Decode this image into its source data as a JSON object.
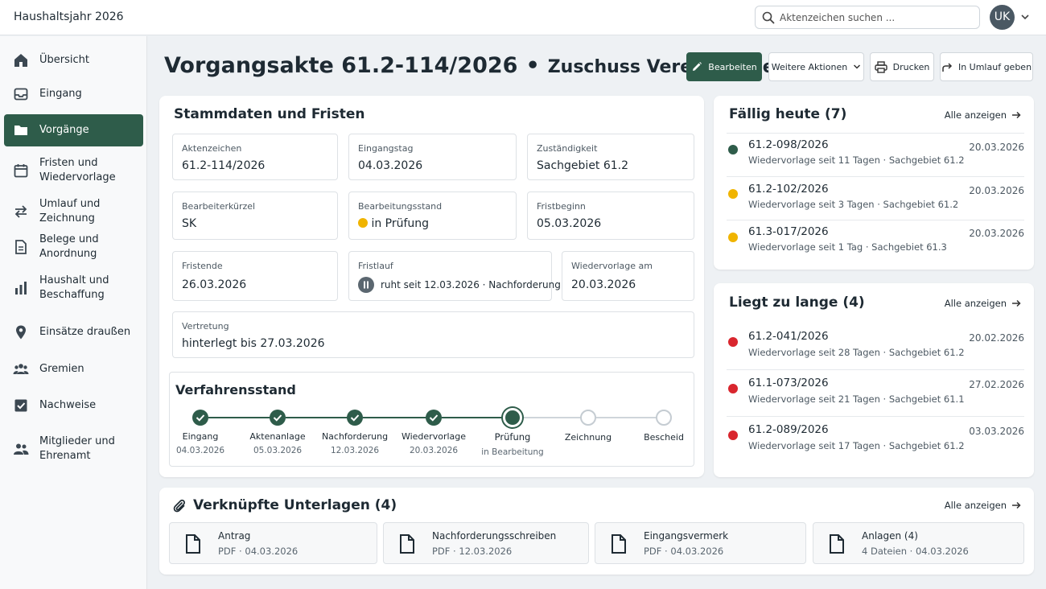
{
  "app": {
    "title": "Haushaltsjahr 2026"
  },
  "search": {
    "placeholder": "Aktenzeichen suchen ..."
  },
  "user": {
    "initials": "UK"
  },
  "sidebar": {
    "items": [
      {
        "label": "Übersicht",
        "icon": "home-icon"
      },
      {
        "label": "Eingang",
        "icon": "inbox-icon"
      },
      {
        "label": "Vorgänge",
        "icon": "folder-icon",
        "active": true
      },
      {
        "label": "Fristen und Wiedervorlage",
        "icon": "calendar-icon"
      },
      {
        "label": "Umlauf und Zeichnung",
        "icon": "swap-icon"
      },
      {
        "label": "Belege und Anordnung",
        "icon": "document-icon"
      },
      {
        "label": "Haushalt und Beschaffung",
        "icon": "bar-chart-icon"
      },
      {
        "label": "Einsätze draußen",
        "icon": "location-pin-icon"
      },
      {
        "label": "Gremien",
        "icon": "group-icon"
      },
      {
        "label": "Nachweise",
        "icon": "checkbox-icon"
      },
      {
        "label": "Mitglieder und Ehrenamt",
        "icon": "people-icon"
      }
    ]
  },
  "header": {
    "title": "Vorgangsakte 61.2-114/2026",
    "separator": "•",
    "subtitle": "Zuschuss Vereinsförderung",
    "buttons": {
      "edit": "Bearbeiten",
      "more": "Weitere Aktionen",
      "print": "Drucken",
      "circulate": "In Umlauf geben"
    }
  },
  "stammdaten": {
    "title": "Stammdaten und Fristen",
    "fields": {
      "aktenzeichen": {
        "label": "Aktenzeichen",
        "value": "61.2-114/2026"
      },
      "eingangstag": {
        "label": "Eingangstag",
        "value": "04.03.2026"
      },
      "zustaendigkeit": {
        "label": "Zuständigkeit",
        "value": "Sachgebiet 61.2"
      },
      "bearbeiterkuerzel": {
        "label": "Bearbeiterkürzel",
        "value": "SK"
      },
      "bearbeitungsstand": {
        "label": "Bearbeitungsstand",
        "value": "in Prüfung",
        "status_color": "#f0b400"
      },
      "fristbeginn": {
        "label": "Fristbeginn",
        "value": "05.03.2026"
      },
      "fristende": {
        "label": "Fristende",
        "value": "26.03.2026"
      },
      "fristlauf": {
        "label": "Fristlauf",
        "value": "ruht seit 12.03.2026 · Nachforderung",
        "icon": "pause-icon"
      },
      "wiedervorlage": {
        "label": "Wiedervorlage am",
        "value": "20.03.2026"
      },
      "vertretung": {
        "label": "Vertretung",
        "value": "hinterlegt bis 27.03.2026"
      }
    }
  },
  "verfahren": {
    "title": "Verfahrensstand",
    "steps": [
      {
        "label": "Eingang",
        "date": "04.03.2026",
        "state": "done"
      },
      {
        "label": "Aktenanlage",
        "date": "05.03.2026",
        "state": "done"
      },
      {
        "label": "Nachforderung",
        "date": "12.03.2026",
        "state": "done"
      },
      {
        "label": "Wiedervorlage",
        "date": "20.03.2026",
        "state": "done"
      },
      {
        "label": "Prüfung",
        "date": "in Bearbeitung",
        "state": "current"
      },
      {
        "label": "Zeichnung",
        "date": "",
        "state": "todo"
      },
      {
        "label": "Bescheid",
        "date": "",
        "state": "todo"
      }
    ]
  },
  "faellig": {
    "title": "Fällig heute (7)",
    "link": "Alle anzeigen",
    "items": [
      {
        "id": "61.2-098/2026",
        "sub": "Wiedervorlage seit 11 Tagen · Sachgebiet 61.2",
        "date": "20.03.2026",
        "color": "#2e5c4a"
      },
      {
        "id": "61.2-102/2026",
        "sub": "Wiedervorlage seit 3 Tagen · Sachgebiet 61.2",
        "date": "20.03.2026",
        "color": "#f0b400"
      },
      {
        "id": "61.3-017/2026",
        "sub": "Wiedervorlage seit 1 Tag · Sachgebiet 61.3",
        "date": "20.03.2026",
        "color": "#f0b400"
      }
    ]
  },
  "zulange": {
    "title": "Liegt zu lange (4)",
    "link": "Alle anzeigen",
    "items": [
      {
        "id": "61.2-041/2026",
        "sub": "Wiedervorlage seit 28 Tagen · Sachgebiet 61.2",
        "date": "20.02.2026",
        "color": "#d9262e"
      },
      {
        "id": "61.1-073/2026",
        "sub": "Wiedervorlage seit 21 Tagen · Sachgebiet 61.1",
        "date": "27.02.2026",
        "color": "#d9262e"
      },
      {
        "id": "61.2-089/2026",
        "sub": "Wiedervorlage seit 17 Tagen · Sachgebiet 61.2",
        "date": "03.03.2026",
        "color": "#d9262e"
      }
    ]
  },
  "unterlagen": {
    "title": "Verknüpfte Unterlagen (4)",
    "link": "Alle anzeigen",
    "items": [
      {
        "name": "Antrag",
        "meta": "PDF · 04.03.2026"
      },
      {
        "name": "Nachforderungsschreiben",
        "meta": "PDF · 12.03.2026"
      },
      {
        "name": "Eingangsvermerk",
        "meta": "PDF · 04.03.2026"
      },
      {
        "name": "Anlagen (4)",
        "meta": "4 Dateien · 04.03.2026"
      }
    ]
  },
  "colors": {
    "accent": "#2e5c4a",
    "warning": "#f0b400",
    "danger": "#d9262e"
  }
}
